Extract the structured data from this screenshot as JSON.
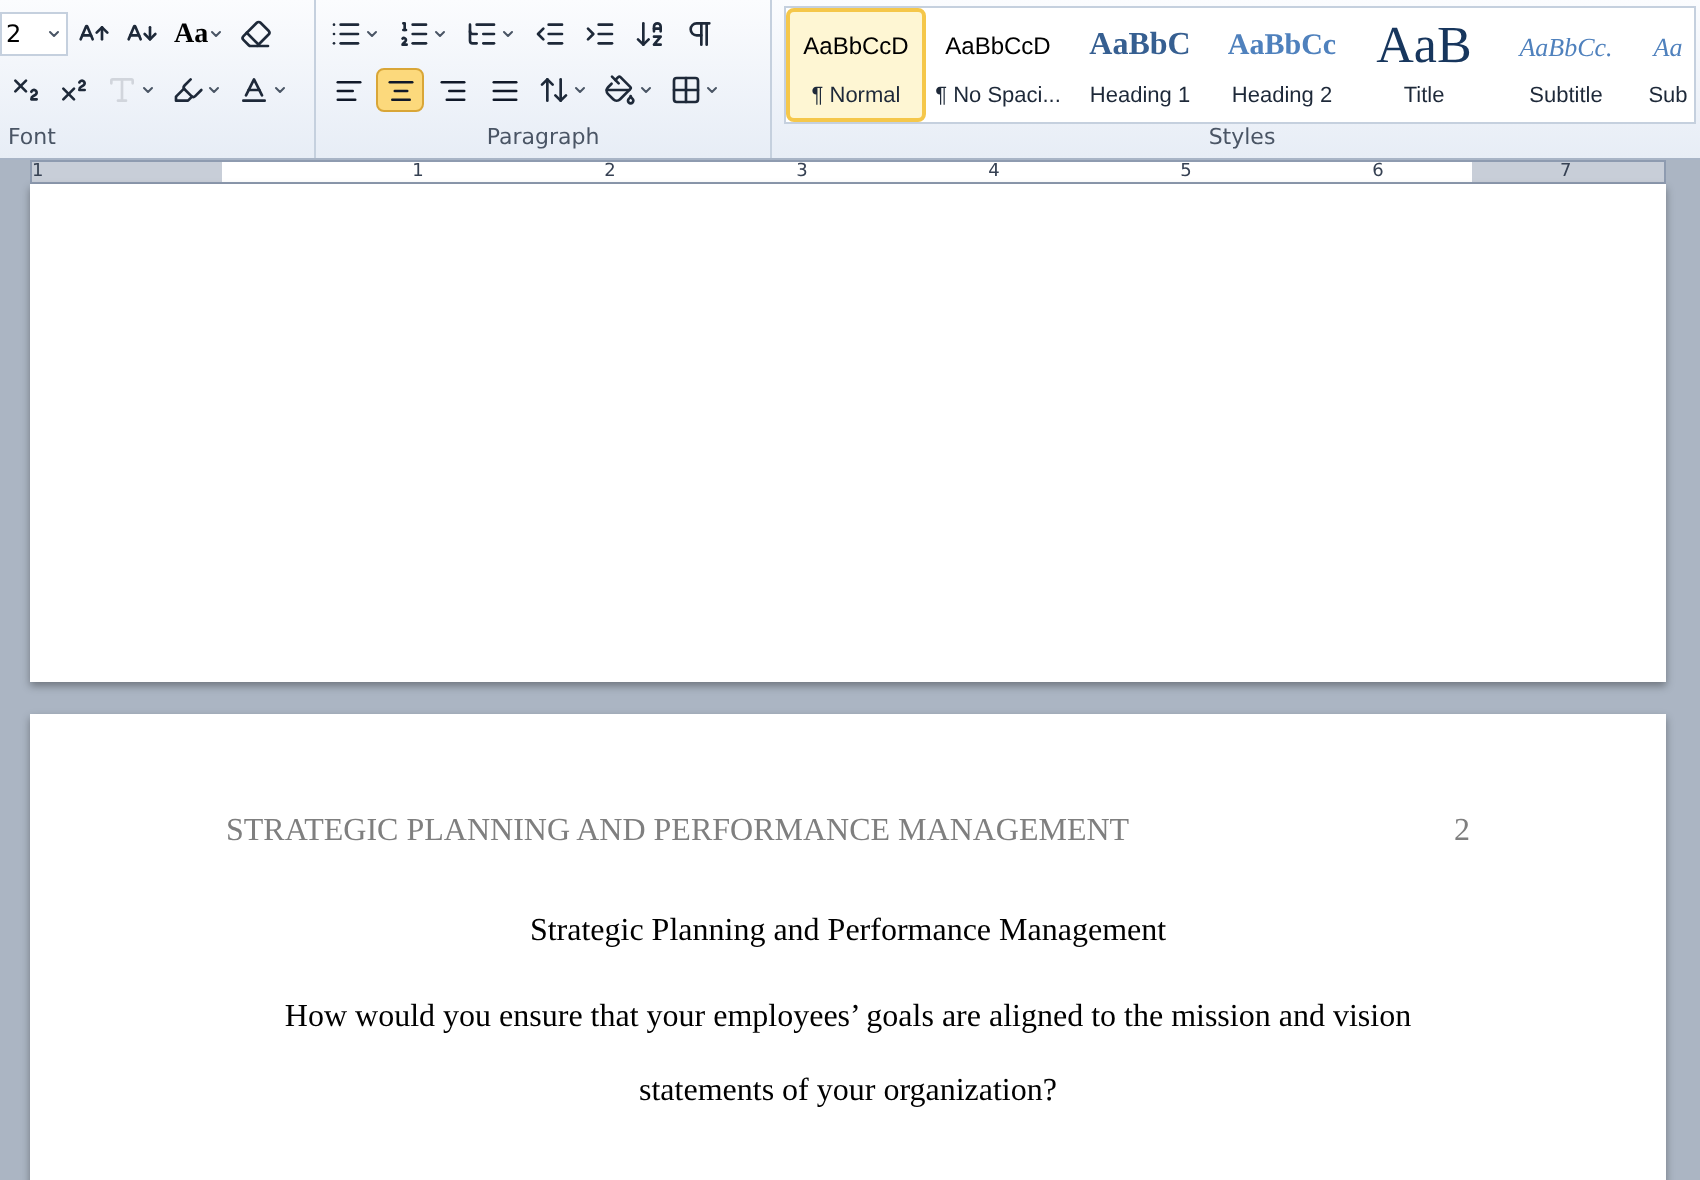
{
  "ribbon": {
    "font": {
      "label": "Font",
      "size_value": "2",
      "case_button": "Aa",
      "text_effects_disabled": true
    },
    "paragraph": {
      "label": "Paragraph",
      "alignment": [
        {
          "kind": "left",
          "selected": false
        },
        {
          "kind": "center",
          "selected": true
        },
        {
          "kind": "right",
          "selected": false
        },
        {
          "kind": "justify",
          "selected": false
        }
      ]
    },
    "styles": {
      "label": "Styles",
      "items": [
        {
          "kind": "normal",
          "preview": "AaBbCcD",
          "label": "¶ Normal",
          "selected": true
        },
        {
          "kind": "normal",
          "preview": "AaBbCcD",
          "label": "¶ No Spaci...",
          "selected": false
        },
        {
          "kind": "heading1",
          "preview": "AaBbC",
          "label": "Heading 1",
          "selected": false
        },
        {
          "kind": "heading2",
          "preview": "AaBbCc",
          "label": "Heading 2",
          "selected": false
        },
        {
          "kind": "title",
          "preview": "AaB",
          "label": "Title",
          "selected": false
        },
        {
          "kind": "subtitle",
          "preview": "AaBbCc.",
          "label": "Subtitle",
          "selected": false
        },
        {
          "kind": "subtitle",
          "preview": "Aa",
          "label": "Sub",
          "selected": false
        }
      ]
    }
  },
  "ruler": {
    "numbers": [
      "1",
      "1",
      "2",
      "3",
      "4",
      "5",
      "6",
      "7"
    ]
  },
  "document": {
    "header": "STRATEGIC PLANNING AND PERFORMANCE MANAGEMENT",
    "page_number": "2",
    "title": "Strategic Planning and Performance Management",
    "paragraph": "How would you ensure that your employees’ goals are aligned to the mission and vision statements of your organization?"
  }
}
